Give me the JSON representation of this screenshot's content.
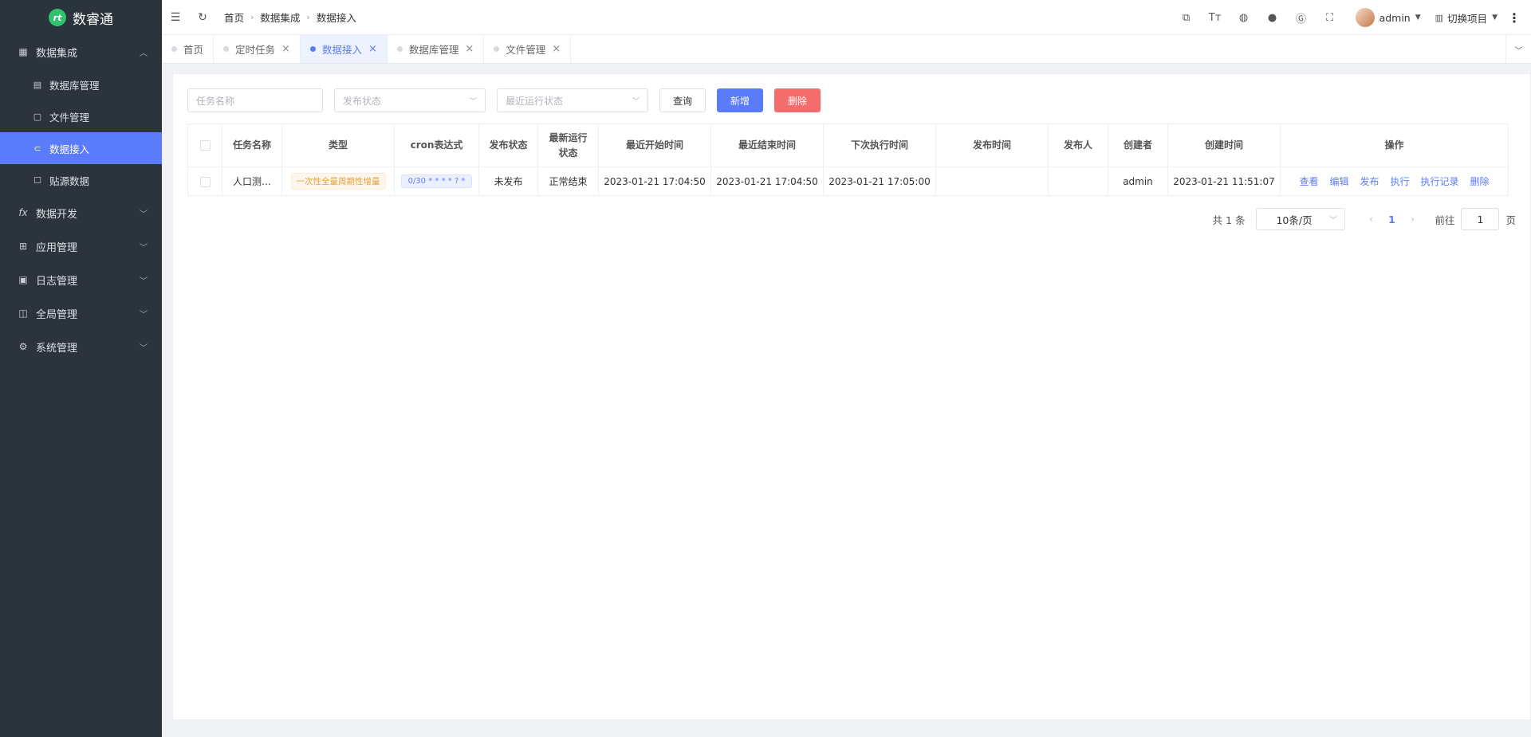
{
  "app": {
    "name": "数睿通",
    "logo_mark": "rt"
  },
  "sidebar": {
    "groups": [
      {
        "label": "数据集成",
        "icon": "grid-icon",
        "expanded": true,
        "items": [
          {
            "label": "数据库管理",
            "icon": "table-icon"
          },
          {
            "label": "文件管理",
            "icon": "file-icon"
          },
          {
            "label": "数据接入",
            "icon": "link-icon",
            "active": true
          },
          {
            "label": "贴源数据",
            "icon": "square-icon"
          }
        ]
      },
      {
        "label": "数据开发",
        "icon": "fx-icon",
        "fx": "fx"
      },
      {
        "label": "应用管理",
        "icon": "apps-icon"
      },
      {
        "label": "日志管理",
        "icon": "log-icon"
      },
      {
        "label": "全局管理",
        "icon": "global-icon"
      },
      {
        "label": "系统管理",
        "icon": "gear-icon"
      }
    ]
  },
  "header": {
    "breadcrumb": [
      "首页",
      "数据集成",
      "数据接入"
    ],
    "user": "admin",
    "project": "切换项目"
  },
  "tabs": [
    {
      "label": "首页",
      "closable": false
    },
    {
      "label": "定时任务",
      "closable": true
    },
    {
      "label": "数据接入",
      "closable": true,
      "active": true
    },
    {
      "label": "数据库管理",
      "closable": true
    },
    {
      "label": "文件管理",
      "closable": true
    }
  ],
  "filters": {
    "task_name_placeholder": "任务名称",
    "publish_status_placeholder": "发布状态",
    "run_status_placeholder": "最近运行状态",
    "query_label": "查询",
    "add_label": "新增",
    "delete_label": "删除"
  },
  "table": {
    "columns": [
      "任务名称",
      "类型",
      "cron表达式",
      "发布状态",
      "最新运行状态",
      "最近开始时间",
      "最近结束时间",
      "下次执行时间",
      "发布时间",
      "发布人",
      "创建者",
      "创建时间",
      "操作"
    ],
    "rows": [
      {
        "task_name": "人口测…",
        "type": "一次性全量周期性增量",
        "cron": "0/30 * * * * ? *",
        "publish_status": "未发布",
        "run_status": "正常结束",
        "last_start": "2023-01-21 17:04:50",
        "last_end": "2023-01-21 17:04:50",
        "next_run": "2023-01-21 17:05:00",
        "publish_time": "",
        "publisher": "",
        "creator": "admin",
        "created_at": "2023-01-21 11:51:07",
        "actions": [
          "查看",
          "编辑",
          "发布",
          "执行",
          "执行记录",
          "删除"
        ]
      }
    ]
  },
  "pagination": {
    "total_text": "共 1 条",
    "page_size": "10条/页",
    "current_page": "1",
    "goto_label": "前往",
    "goto_value": "1",
    "page_suffix": "页"
  },
  "colors": {
    "sidebar_bg": "#2b333d",
    "accent": "#5b7cfa",
    "danger": "#f56c6c"
  }
}
